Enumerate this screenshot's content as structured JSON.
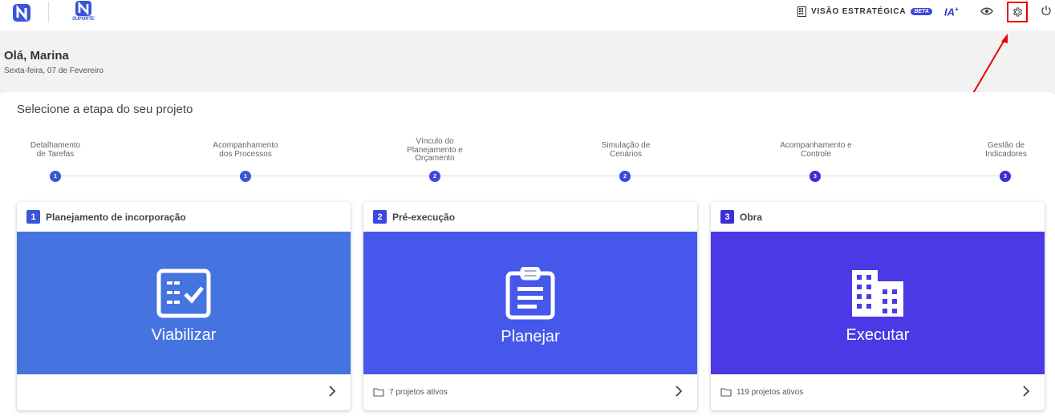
{
  "header": {
    "suporte_label": "SUPORTE",
    "visao_label": "VISÃO ESTRATÉGICA",
    "beta_badge": "BETA",
    "ia_label": "IA",
    "ia_sup": "+",
    "icons": [
      "brand-logo-icon",
      "suporte-logo-icon",
      "building-icon",
      "eye-icon",
      "gear-icon",
      "power-icon"
    ],
    "accent": "#3a45d6",
    "highlight_color": "#e00000"
  },
  "greeting": {
    "title": "Olá, Marina",
    "date": "Sexta-feira, 07 de Fevereiro"
  },
  "main": {
    "title": "Selecione a etapa do seu projeto",
    "steps": [
      {
        "label": "Detalhamento de Tarefas",
        "num": "1"
      },
      {
        "label": "Acompanhamento dos Processos",
        "num": "1"
      },
      {
        "label": "Vínculo do Planejamento e Orçamento",
        "num": "2"
      },
      {
        "label": "Simulação de Cenários",
        "num": "2"
      },
      {
        "label": "Acompanhamento e Controle",
        "num": "3"
      },
      {
        "label": "Gestão de Indicadores",
        "num": "3"
      }
    ],
    "cards": [
      {
        "num": "1",
        "title": "Planejamento de incorporação",
        "action": "Viabilizar",
        "footer": "",
        "color": "#4574e0",
        "icon": "checklist-icon"
      },
      {
        "num": "2",
        "title": "Pré-execução",
        "action": "Planejar",
        "footer": "7 projetos ativos",
        "color": "#4657ec",
        "icon": "clipboard-icon"
      },
      {
        "num": "3",
        "title": "Obra",
        "action": "Executar",
        "footer": "119 projetos ativos",
        "color": "#4b39e6",
        "icon": "city-building-icon"
      }
    ],
    "step_colors": {
      "1": "#3a56d6",
      "2": "#3b48e0",
      "3": "#3a2fd8"
    }
  }
}
